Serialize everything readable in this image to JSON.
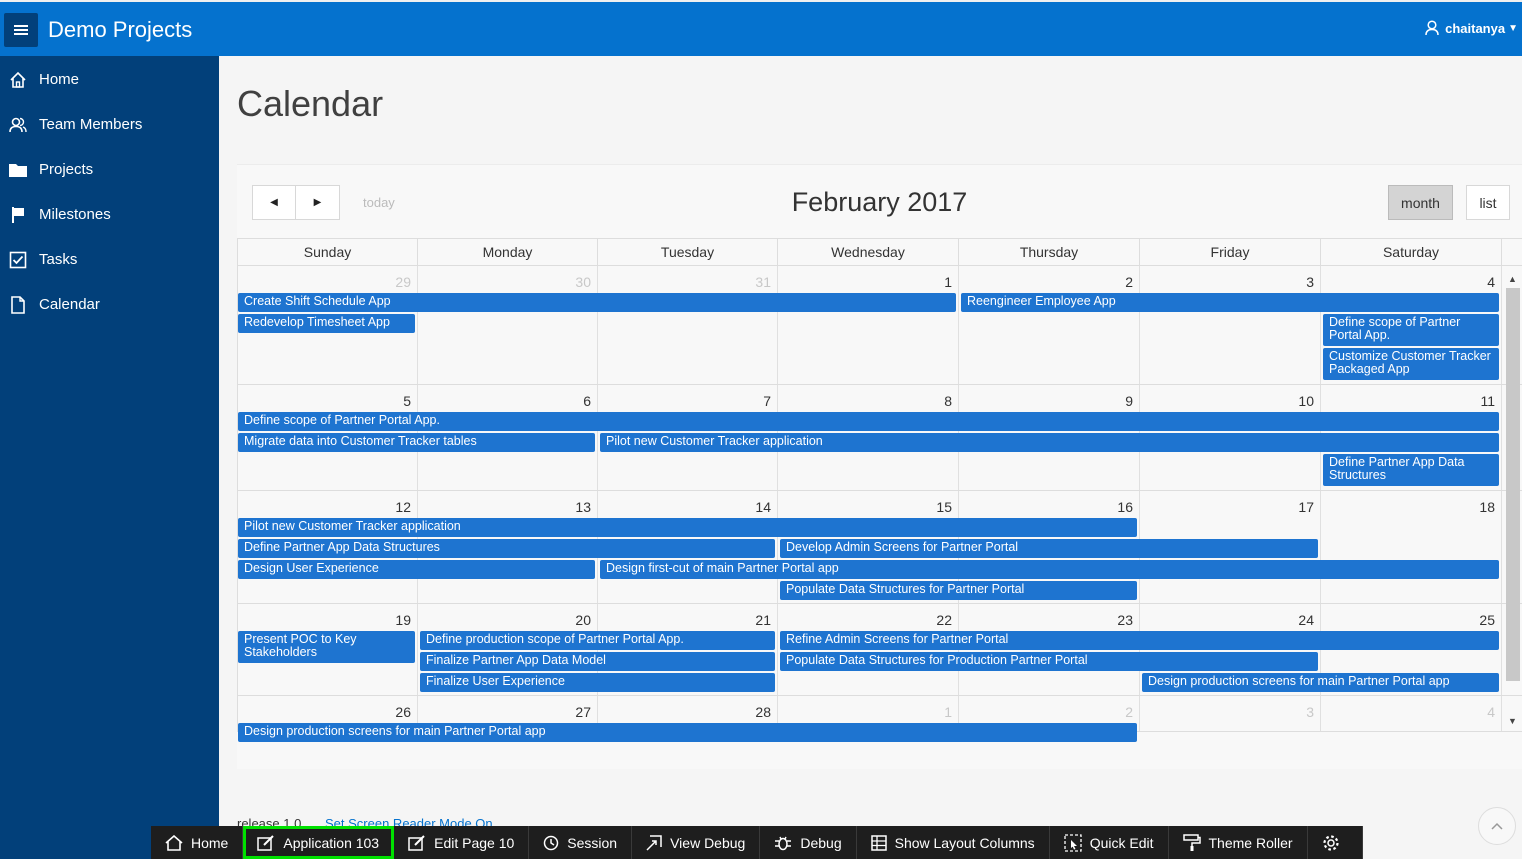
{
  "header": {
    "app_title": "Demo Projects",
    "user_name": "chaitanya"
  },
  "sidebar": {
    "items": [
      {
        "label": "Home",
        "icon": "home-icon"
      },
      {
        "label": "Team Members",
        "icon": "users-icon"
      },
      {
        "label": "Projects",
        "icon": "folder-icon"
      },
      {
        "label": "Milestones",
        "icon": "flag-icon"
      },
      {
        "label": "Tasks",
        "icon": "checkbox-icon"
      },
      {
        "label": "Calendar",
        "icon": "file-icon"
      }
    ]
  },
  "page": {
    "title": "Calendar"
  },
  "calendar": {
    "title": "February 2017",
    "today_label": "today",
    "month_label": "month",
    "list_label": "list",
    "days_of_week": [
      "Sunday",
      "Monday",
      "Tuesday",
      "Wednesday",
      "Thursday",
      "Friday",
      "Saturday"
    ],
    "weeks": [
      {
        "days": [
          {
            "n": "29",
            "other": true
          },
          {
            "n": "30",
            "other": true
          },
          {
            "n": "31",
            "other": true
          },
          {
            "n": "1"
          },
          {
            "n": "2"
          },
          {
            "n": "3"
          },
          {
            "n": "4"
          }
        ],
        "events": [
          {
            "title": "Create Shift Schedule App",
            "start": 0,
            "end": 3,
            "row": 0
          },
          {
            "title": "Reengineer Employee App",
            "start": 4,
            "end": 6,
            "row": 0
          },
          {
            "title": "Redevelop Timesheet App",
            "start": 0,
            "end": 0,
            "row": 1
          },
          {
            "title": "Define scope of Partner Portal App.",
            "start": 6,
            "end": 6,
            "row": 1,
            "two": true
          },
          {
            "title": "Customize Customer Tracker Packaged App",
            "start": 6,
            "end": 6,
            "row": 2.6,
            "two": true
          }
        ]
      },
      {
        "days": [
          {
            "n": "5"
          },
          {
            "n": "6"
          },
          {
            "n": "7"
          },
          {
            "n": "8"
          },
          {
            "n": "9"
          },
          {
            "n": "10"
          },
          {
            "n": "11"
          }
        ],
        "events": [
          {
            "title": "Define scope of Partner Portal App.",
            "start": 0,
            "end": 6,
            "row": 0
          },
          {
            "title": "Migrate data into Customer Tracker tables",
            "start": 0,
            "end": 1,
            "row": 1
          },
          {
            "title": "Pilot new Customer Tracker application",
            "start": 2,
            "end": 6,
            "row": 1
          },
          {
            "title": "Define Partner App Data Structures",
            "start": 6,
            "end": 6,
            "row": 2,
            "two": true
          }
        ]
      },
      {
        "days": [
          {
            "n": "12"
          },
          {
            "n": "13"
          },
          {
            "n": "14"
          },
          {
            "n": "15"
          },
          {
            "n": "16"
          },
          {
            "n": "17"
          },
          {
            "n": "18"
          }
        ],
        "events": [
          {
            "title": "Pilot new Customer Tracker application",
            "start": 0,
            "end": 4,
            "row": 0
          },
          {
            "title": "Define Partner App Data Structures",
            "start": 0,
            "end": 2,
            "row": 1
          },
          {
            "title": "Develop Admin Screens for Partner Portal",
            "start": 3,
            "end": 5,
            "row": 1
          },
          {
            "title": "Design User Experience",
            "start": 0,
            "end": 1,
            "row": 2
          },
          {
            "title": "Design first-cut of main Partner Portal app",
            "start": 2,
            "end": 6,
            "row": 2
          },
          {
            "title": "Populate Data Structures for Partner Portal",
            "start": 3,
            "end": 4,
            "row": 3
          }
        ]
      },
      {
        "days": [
          {
            "n": "19"
          },
          {
            "n": "20"
          },
          {
            "n": "21"
          },
          {
            "n": "22"
          },
          {
            "n": "23"
          },
          {
            "n": "24"
          },
          {
            "n": "25"
          }
        ],
        "events": [
          {
            "title": "Present POC to Key Stakeholders",
            "start": 0,
            "end": 0,
            "row": 0,
            "two": true
          },
          {
            "title": "Define production scope of Partner Portal App.",
            "start": 1,
            "end": 2,
            "row": 0
          },
          {
            "title": "Refine Admin Screens for Partner Portal",
            "start": 3,
            "end": 6,
            "row": 0
          },
          {
            "title": "Finalize Partner App Data Model",
            "start": 1,
            "end": 2,
            "row": 1
          },
          {
            "title": "Populate Data Structures for Production Partner Portal",
            "start": 3,
            "end": 5,
            "row": 1
          },
          {
            "title": "Finalize User Experience",
            "start": 1,
            "end": 2,
            "row": 2
          },
          {
            "title": "Design production screens for main Partner Portal app",
            "start": 5,
            "end": 6,
            "row": 2
          }
        ]
      },
      {
        "days": [
          {
            "n": "26"
          },
          {
            "n": "27"
          },
          {
            "n": "28"
          },
          {
            "n": "1",
            "other": true
          },
          {
            "n": "2",
            "other": true
          },
          {
            "n": "3",
            "other": true
          },
          {
            "n": "4",
            "other": true
          }
        ],
        "events": [
          {
            "title": "Design production screens for main Partner Portal app",
            "start": 0,
            "end": 4,
            "row": 0
          }
        ]
      }
    ]
  },
  "footer": {
    "release": "release 1.0",
    "screen_reader_link": "Set Screen Reader Mode On"
  },
  "devbar": {
    "items": [
      {
        "label": "Home",
        "icon": "home-icon"
      },
      {
        "label": "Application 103",
        "icon": "edit-icon",
        "highlight": true
      },
      {
        "label": "Edit Page 10",
        "icon": "edit-page-icon"
      },
      {
        "label": "Session",
        "icon": "clock-icon"
      },
      {
        "label": "View Debug",
        "icon": "view-debug-icon"
      },
      {
        "label": "Debug",
        "icon": "bug-icon"
      },
      {
        "label": "Show Layout Columns",
        "icon": "grid-icon"
      },
      {
        "label": "Quick Edit",
        "icon": "cursor-icon"
      },
      {
        "label": "Theme Roller",
        "icon": "paint-roller-icon"
      },
      {
        "label": "",
        "icon": "gear-icon"
      }
    ]
  },
  "colors": {
    "header": "#0572ce",
    "sidebar": "#02407a",
    "event": "#1e74d0",
    "highlight": "#00e000"
  }
}
